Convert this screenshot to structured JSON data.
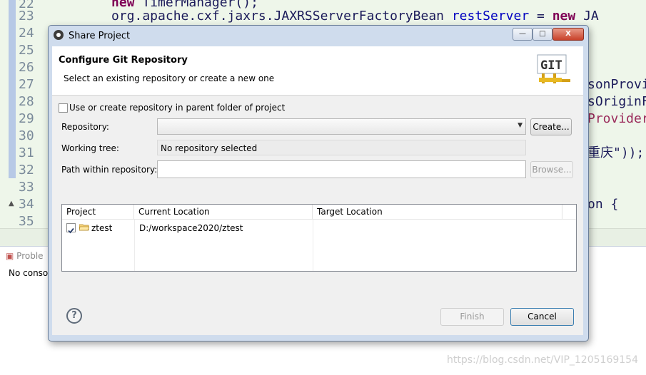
{
  "editor": {
    "line_numbers": [
      "22",
      "23",
      "24",
      "25",
      "26",
      "27",
      "28",
      "29",
      "30",
      "31",
      "32",
      "33",
      "34",
      "35"
    ],
    "code_line_22": {
      "keyword": "new",
      "rest": " TimerManager();"
    },
    "code_line_23": {
      "text": "org.apache.cxf.jaxrs.JAXRSServerFactoryBean ",
      "var": "restServer",
      "eq": " = ",
      "kw": "new",
      "tail": " JA"
    },
    "right_fragments": {
      "l27": "sonProvi",
      "l28": "sOriginF",
      "l29": "Provider",
      "l31": "重庆\"));",
      "l34": "on {"
    }
  },
  "bottom_panel": {
    "tab_label": "Proble",
    "content": "No conso"
  },
  "watermark": "https://blog.csdn.net/VIP_1205169154",
  "dialog": {
    "title": "Share Project",
    "window_buttons": {
      "minimize": "—",
      "maximize": "□",
      "close": "X"
    },
    "header": {
      "title": "Configure Git Repository",
      "description": "Select an existing repository or create a new one",
      "logo_text": "GIT"
    },
    "use_parent_checkbox": {
      "label": "Use or create repository in parent folder of project",
      "checked": false
    },
    "repository": {
      "label": "Repository:",
      "value": "",
      "create_button": "Create..."
    },
    "working_tree": {
      "label": "Working tree:",
      "value": "No repository selected"
    },
    "path_within": {
      "label": "Path within repository:",
      "value": "",
      "browse_button": "Browse..."
    },
    "table": {
      "columns": [
        "Project",
        "Current Location",
        "Target Location"
      ],
      "rows": [
        {
          "checked": true,
          "project": "ztest",
          "current_location": "D:/workspace2020/ztest",
          "target_location": ""
        }
      ]
    },
    "footer": {
      "help": "?",
      "finish": "Finish",
      "cancel": "Cancel"
    }
  },
  "colors": {
    "dialog_frame": "#cfdced",
    "keyword": "#7f0055",
    "editor_bg": "#eef6ea"
  },
  "icons": [
    "share-project-icon",
    "git-logo-icon",
    "folder-icon",
    "help-icon",
    "combo-arrow-icon"
  ]
}
